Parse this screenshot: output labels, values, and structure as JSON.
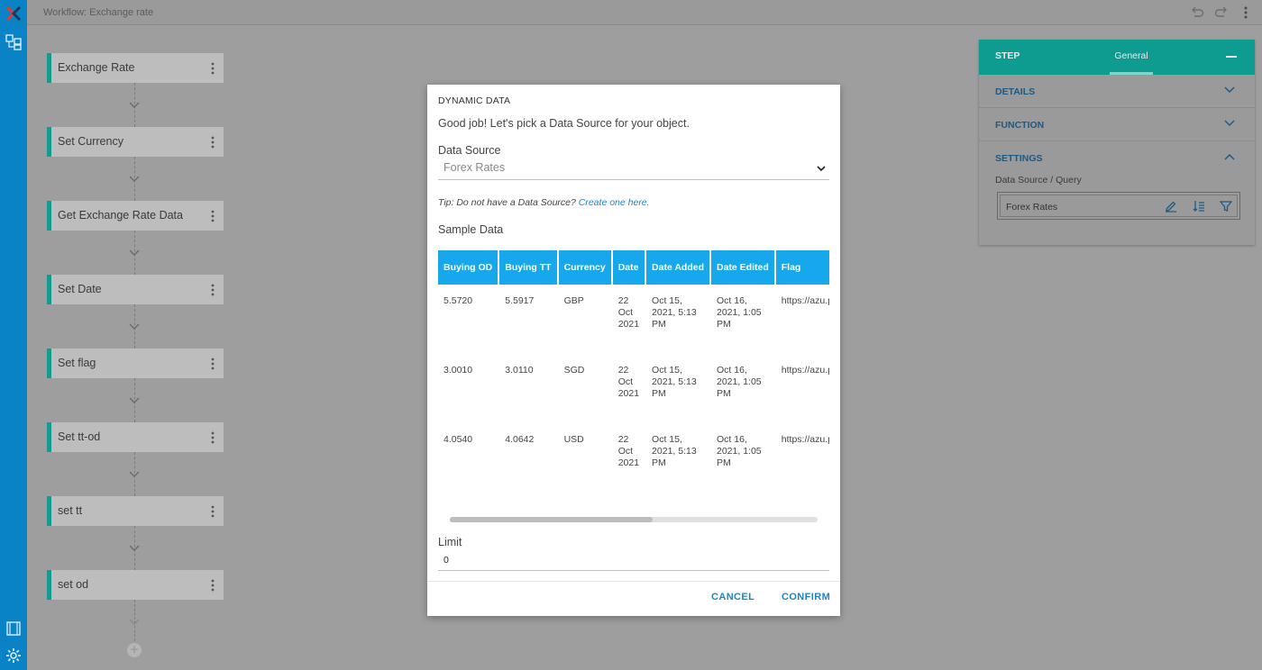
{
  "app": {
    "title": "Workflow: Exchange rate"
  },
  "workflow": {
    "steps": [
      {
        "label": "Exchange Rate"
      },
      {
        "label": "Set Currency"
      },
      {
        "label": "Get Exchange Rate Data"
      },
      {
        "label": "Set Date"
      },
      {
        "label": "Set flag"
      },
      {
        "label": "Set tt-od"
      },
      {
        "label": "set tt"
      },
      {
        "label": "set od"
      }
    ]
  },
  "panel": {
    "tab_step": "STEP",
    "tab_general": "General",
    "sections": {
      "details": "DETAILS",
      "function": "FUNCTION",
      "settings": "SETTINGS"
    },
    "query_label": "Data Source / Query",
    "query_value": "Forex Rates"
  },
  "dialog": {
    "title": "DYNAMIC DATA",
    "intro": "Good job! Let's pick a Data Source for your object.",
    "data_source_label": "Data Source",
    "data_source_value": "Forex Rates",
    "tip_text": "Tip: Do not have a Data Source?",
    "tip_link": "Create one here.",
    "sample_label": "Sample Data",
    "table": {
      "columns": [
        "Buying OD",
        "Buying TT",
        "Currency",
        "Date",
        "Date Added",
        "Date Edited",
        "Flag"
      ],
      "rows": [
        [
          "5.5720",
          "3.0010",
          "4.0540"
        ],
        []
      ],
      "row_data": [
        {
          "buying_od": "5.5720",
          "buying_tt": "5.5917",
          "currency": "GBP",
          "date": "22 Oct 2021",
          "date_added": "Oct 15, 2021, 5:13 PM",
          "date_edited": "Oct 16, 2021, 1:05 PM",
          "flag": "https://azu.pro"
        },
        {
          "buying_od": "3.0010",
          "buying_tt": "3.0110",
          "currency": "SGD",
          "date": "22 Oct 2021",
          "date_added": "Oct 15, 2021, 5:13 PM",
          "date_edited": "Oct 16, 2021, 1:05 PM",
          "flag": "https://azu.pro"
        },
        {
          "buying_od": "4.0540",
          "buying_tt": "4.0642",
          "currency": "USD",
          "date": "22 Oct 2021",
          "date_added": "Oct 15, 2021, 5:13 PM",
          "date_edited": "Oct 16, 2021, 1:05 PM",
          "flag": "https://azu.pro"
        }
      ]
    },
    "limit_label": "Limit",
    "limit_value": "0",
    "cancel_label": "CANCEL",
    "confirm_label": "CONFIRM"
  },
  "colors": {
    "rail": "#0a83c6",
    "accent": "#0f9c90",
    "table_header": "#16a8ea",
    "link": "#1b86c6"
  }
}
